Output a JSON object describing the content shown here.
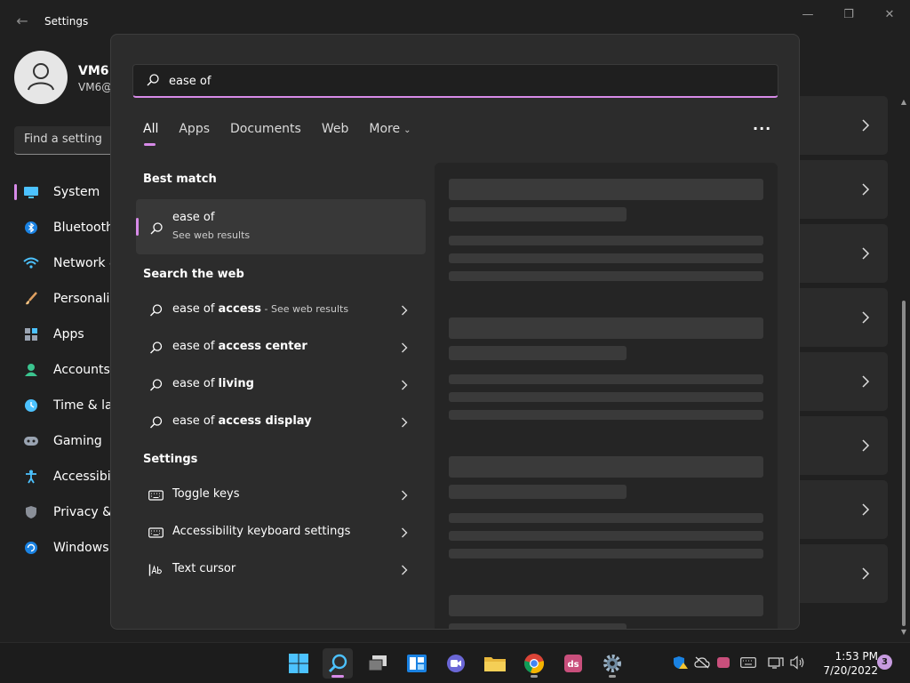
{
  "settings_window": {
    "title": "Settings",
    "user": {
      "name": "VM6",
      "sub": "VM6@"
    },
    "find_placeholder": "Find a setting",
    "nav": [
      {
        "label": "System",
        "icon": "system-icon",
        "active": true
      },
      {
        "label": "Bluetooth",
        "icon": "bluetooth-icon"
      },
      {
        "label": "Network &",
        "icon": "wifi-icon"
      },
      {
        "label": "Personaliza",
        "icon": "brush-icon"
      },
      {
        "label": "Apps",
        "icon": "apps-icon"
      },
      {
        "label": "Accounts",
        "icon": "person-icon"
      },
      {
        "label": "Time & lan",
        "icon": "clock-icon"
      },
      {
        "label": "Gaming",
        "icon": "gamepad-icon"
      },
      {
        "label": "Accessibilit",
        "icon": "accessibility-icon"
      },
      {
        "label": "Privacy & s",
        "icon": "shield-icon"
      },
      {
        "label": "Windows U",
        "icon": "update-icon"
      }
    ]
  },
  "search": {
    "query": "ease of",
    "tabs": [
      {
        "label": "All",
        "active": true
      },
      {
        "label": "Apps"
      },
      {
        "label": "Documents"
      },
      {
        "label": "Web"
      },
      {
        "label": "More"
      }
    ],
    "best_match": {
      "heading": "Best match",
      "title": "ease of",
      "subtitle": "See web results"
    },
    "web": {
      "heading": "Search the web",
      "items": [
        {
          "prefix": "ease of ",
          "bold": "access",
          "suffix": " - See web results"
        },
        {
          "prefix": "ease of ",
          "bold": "access center",
          "suffix": ""
        },
        {
          "prefix": "ease of ",
          "bold": "living",
          "suffix": ""
        },
        {
          "prefix": "ease of ",
          "bold": "access display",
          "suffix": ""
        }
      ]
    },
    "settings": {
      "heading": "Settings",
      "items": [
        {
          "label": "Toggle keys",
          "icon": "keyboard-icon"
        },
        {
          "label": "Accessibility keyboard settings",
          "icon": "keyboard-icon"
        },
        {
          "label": "Text cursor",
          "icon": "text-cursor-icon"
        }
      ]
    }
  },
  "taskbar": {
    "time": "1:53 PM",
    "date": "7/20/2022",
    "notification_count": "3"
  },
  "colors": {
    "accent": "#d78ae8",
    "panel": "#2c2c2c",
    "background": "#202020"
  }
}
